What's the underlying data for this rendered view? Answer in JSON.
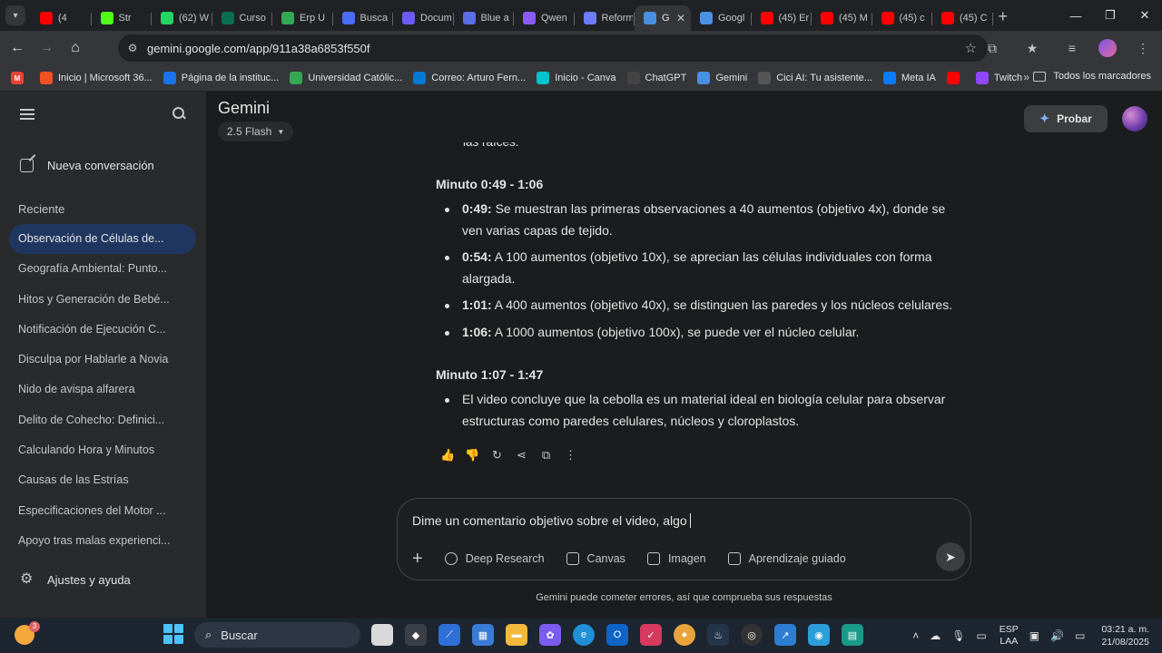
{
  "browser": {
    "tabs": [
      {
        "title": "(4",
        "color": "#ff0000",
        "icon": "youtube-icon"
      },
      {
        "title": "Str",
        "color": "#53fc18",
        "icon": "kick-icon"
      },
      {
        "title": "(62) W",
        "color": "#25d366",
        "icon": "whatsapp-icon"
      },
      {
        "title": "Curso",
        "color": "#0b6e4f",
        "icon": "course-icon"
      },
      {
        "title": "Erp U",
        "color": "#34a853",
        "icon": "erp-icon"
      },
      {
        "title": "Busca",
        "color": "#4a6cf7",
        "icon": "search-site-icon"
      },
      {
        "title": "Docum",
        "color": "#6b5cf6",
        "icon": "docs-icon"
      },
      {
        "title": "Blue a",
        "color": "#5b6ee8",
        "icon": "blue-icon"
      },
      {
        "title": "Qwen",
        "color": "#8a5cf6",
        "icon": "qwen-icon"
      },
      {
        "title": "Reform",
        "color": "#6b7cff",
        "icon": "reform-icon"
      },
      {
        "title": "G",
        "color": "#4a90e2",
        "icon": "gemini-icon",
        "active": true
      },
      {
        "title": "Googl",
        "color": "#4a90e2",
        "icon": "gemini-icon"
      },
      {
        "title": "(45) Er",
        "color": "#ff0000",
        "icon": "youtube-icon"
      },
      {
        "title": "(45) M",
        "color": "#ff0000",
        "icon": "youtube-icon"
      },
      {
        "title": "(45) c",
        "color": "#ff0000",
        "icon": "youtube-icon"
      },
      {
        "title": "(45) C",
        "color": "#ff0000",
        "icon": "youtube-icon"
      }
    ],
    "url": "gemini.google.com/app/911a38a6853f550f",
    "bookmarks": [
      {
        "label": "Inicio | Microsoft 36...",
        "color": "#f25022"
      },
      {
        "label": "Página de la instituc...",
        "color": "#1a73e8"
      },
      {
        "label": "Universidad Católic...",
        "color": "#34a853"
      },
      {
        "label": "Correo: Arturo Fern...",
        "color": "#0078d4"
      },
      {
        "label": "Inicio - Canva",
        "color": "#00c4cc"
      },
      {
        "label": "ChatGPT",
        "color": "#444444"
      },
      {
        "label": "Gemini",
        "color": "#4a90e2"
      },
      {
        "label": "Cici AI: Tu asistente...",
        "color": "#555555"
      },
      {
        "label": "Meta IA",
        "color": "#0a7cff"
      },
      {
        "label": "",
        "color": "#ff0000"
      },
      {
        "label": "Twitch",
        "color": "#9146ff"
      }
    ],
    "all_bookmarks": "Todos los marcadores"
  },
  "sidebar": {
    "new_chat": "Nueva conversación",
    "recent_label": "Reciente",
    "items": [
      "Observación de Células de...",
      "Geografía Ambiental: Punto...",
      "Hitos y Generación de Bebé...",
      "Notificación de Ejecución C...",
      "Disculpa por Hablarle a Novia",
      "Nido de avispa alfarera",
      "Delito de Cohecho: Definici...",
      "Calculando Hora y Minutos",
      "Causas de las Estrías",
      "Especificaciones del Motor ...",
      "Apoyo tras malas experienci..."
    ],
    "settings": "Ajustes y ayuda"
  },
  "header": {
    "title": "Gemini",
    "model": "2.5 Flash",
    "probar": "Probar"
  },
  "response": {
    "cut_text": "las raíces.",
    "section1": {
      "title": "Minuto 0:49 - 1:06",
      "bullets": [
        {
          "time": "0:49:",
          "text": " Se muestran las primeras observaciones a 40 aumentos (objetivo 4x), donde se ven varias capas de tejido."
        },
        {
          "time": "0:54:",
          "text": " A 100 aumentos (objetivo 10x), se aprecian las células individuales con forma alargada."
        },
        {
          "time": "1:01:",
          "text": " A 400 aumentos (objetivo 40x), se distinguen las paredes y los núcleos celulares."
        },
        {
          "time": "1:06:",
          "text": " A 1000 aumentos (objetivo 100x), se puede ver el núcleo celular."
        }
      ]
    },
    "section2": {
      "title": "Minuto 1:07 - 1:47",
      "bullets": [
        {
          "text": "El video concluye que la cebolla es un material ideal en biología celular para observar estructuras como paredes celulares, núcleos y cloroplastos."
        }
      ]
    }
  },
  "composer": {
    "prompt": "Dime un comentario objetivo sobre el video, algo",
    "tools": [
      "Deep Research",
      "Canvas",
      "Imagen",
      "Aprendizaje guiado"
    ],
    "disclaimer": "Gemini puede cometer errores, así que comprueba sus respuestas"
  },
  "taskbar": {
    "weather_badge": "3",
    "search": "Buscar",
    "lang_1": "ESP",
    "lang_2": "LAA",
    "time": "03:21 a. m.",
    "date": "21/08/2025"
  }
}
